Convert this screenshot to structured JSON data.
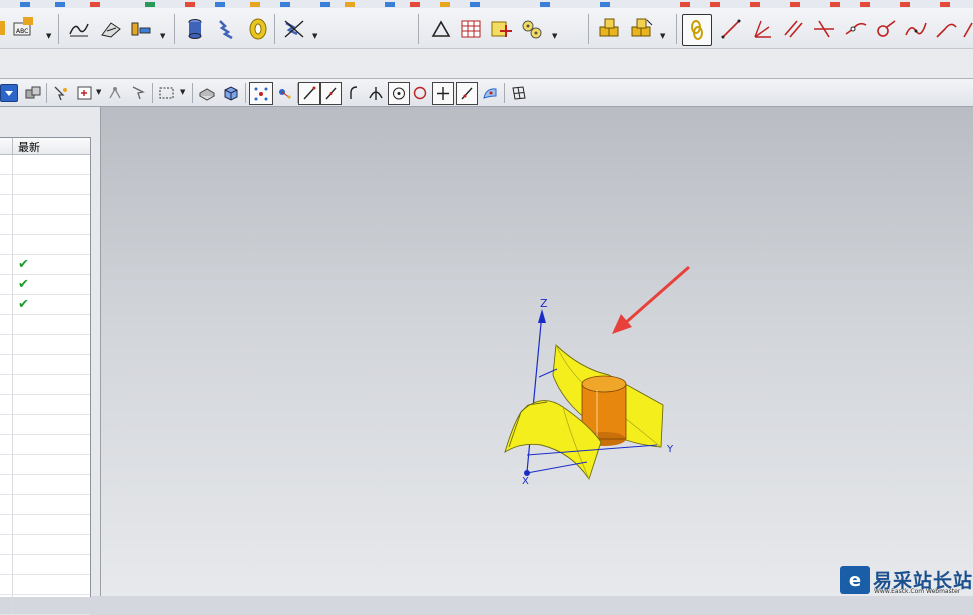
{
  "navigator": {
    "column_latest": "最新",
    "rows": [
      {
        "latest": false
      },
      {
        "latest": false
      },
      {
        "latest": false
      },
      {
        "latest": false
      },
      {
        "latest": false
      },
      {
        "latest": true
      },
      {
        "latest": true
      },
      {
        "latest": true
      },
      {
        "latest": false
      },
      {
        "latest": false
      },
      {
        "latest": false
      },
      {
        "latest": false
      },
      {
        "latest": false
      },
      {
        "latest": false
      },
      {
        "latest": false
      },
      {
        "latest": false
      },
      {
        "latest": false
      },
      {
        "latest": false
      },
      {
        "latest": false
      },
      {
        "latest": false
      },
      {
        "latest": false
      },
      {
        "latest": false
      },
      {
        "latest": false
      }
    ],
    "check_glyph": "✔"
  },
  "viewport": {
    "axis_labels": {
      "z": "Z",
      "y": "Y",
      "x": "X"
    },
    "colors": {
      "surface": "#f4ef1c",
      "cylinder": "#e8870e",
      "arrow": "#e8403a",
      "axis": "#1a2cc8"
    }
  },
  "watermark": {
    "logo_glyph": "e",
    "title": "易采站长站",
    "subtitle": "Www.Easck.Com Webmaster"
  }
}
